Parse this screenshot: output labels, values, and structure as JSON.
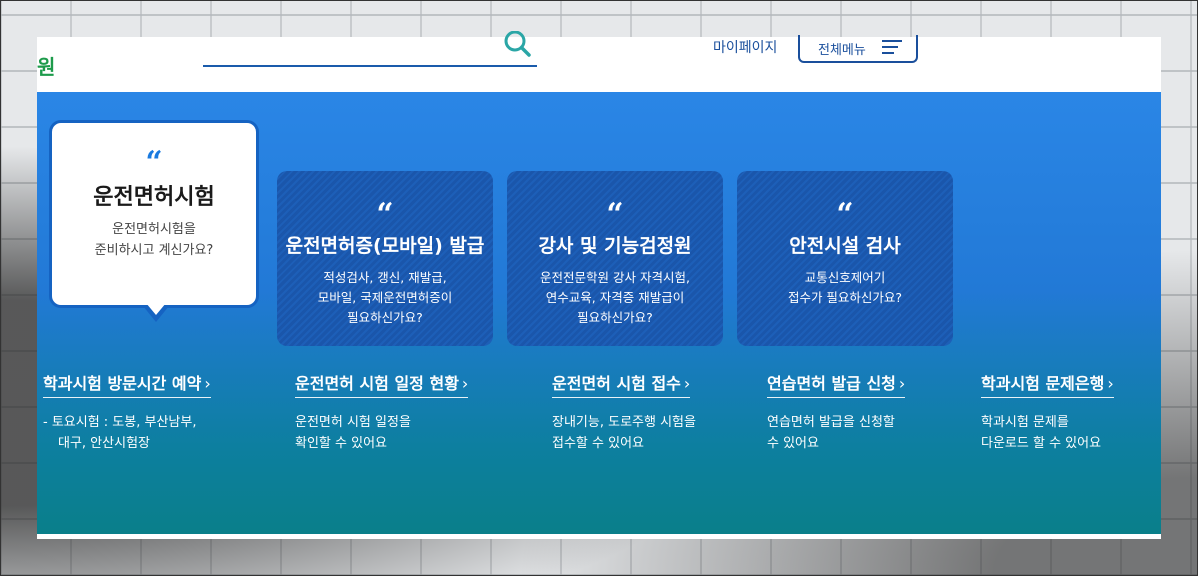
{
  "header": {
    "logo_text": "원",
    "search": {
      "value": "",
      "placeholder": ""
    },
    "mypage_label": "마이페이지",
    "allmenu_label": "전체메뉴"
  },
  "cards": [
    {
      "quote": "“",
      "title": "운전면허시험",
      "desc_lines": [
        "운전면허시험을",
        "준비하시고 계신가요?"
      ]
    },
    {
      "quote": "“",
      "title": "운전면허증(모바일) 발급",
      "desc_lines": [
        "적성검사, 갱신, 재발급,",
        "모바일, 국제운전면허증이",
        "필요하신가요?"
      ]
    },
    {
      "quote": "“",
      "title": "강사 및 기능검정원",
      "desc_lines": [
        "운전전문학원 강사 자격시험,",
        "연수교육, 자격증 재발급이",
        "필요하신가요?"
      ]
    },
    {
      "quote": "“",
      "title": "안전시설 검사",
      "desc_lines": [
        "교통신호제어기",
        "접수가 필요하신가요?"
      ]
    }
  ],
  "links": [
    {
      "title": "학과시험 방문시간 예약",
      "chevron": "›",
      "desc_lines": [
        "- 토요시험 : 도봉, 부산남부,",
        "대구, 안산시험장"
      ]
    },
    {
      "title": "운전면허 시험 일정 현황",
      "chevron": "›",
      "desc_lines": [
        "운전면허 시험 일정을",
        "확인할 수 있어요"
      ]
    },
    {
      "title": "운전면허 시험 접수",
      "chevron": "›",
      "desc_lines": [
        "장내기능, 도로주행 시험을",
        "접수할 수 있어요"
      ]
    },
    {
      "title": "연습면허 발급 신청",
      "chevron": "›",
      "desc_lines": [
        "연습면허 발급을 신청할",
        "수 있어요"
      ]
    },
    {
      "title": "학과시험 문제은행",
      "chevron": "›",
      "desc_lines": [
        "학과시험 문제를",
        "다운로드 할 수 있어요"
      ]
    }
  ],
  "colors": {
    "brand_green": "#1d9b4b",
    "brand_blue": "#1a4f9c",
    "accent_blue": "#1563c2"
  }
}
